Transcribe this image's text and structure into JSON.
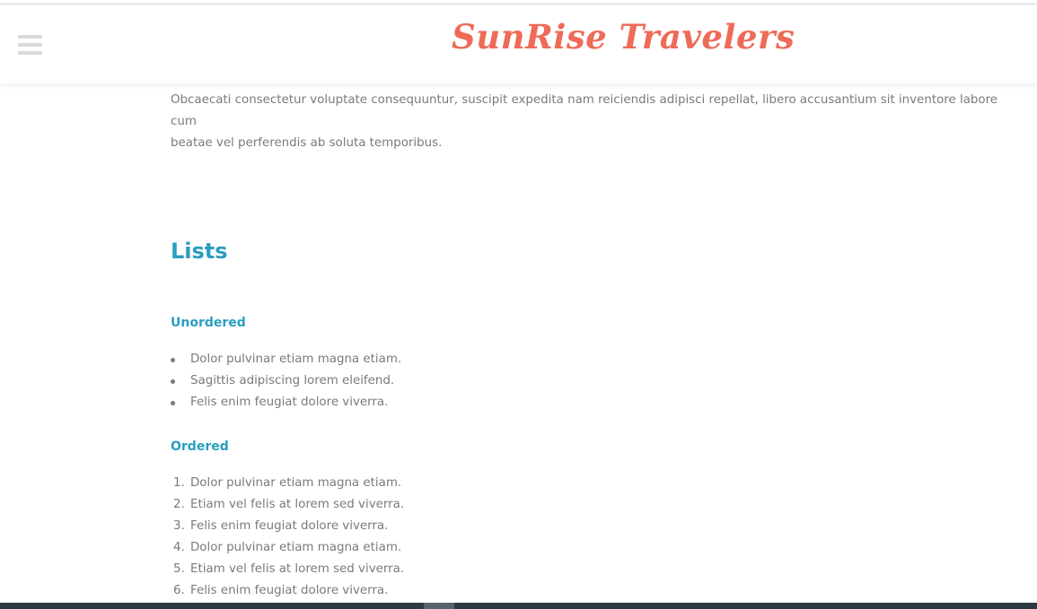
{
  "header": {
    "brand": "SunRise Travelers",
    "menu_icon": "hamburger-menu-icon"
  },
  "content": {
    "paragraph_lines": [
      "Obcaecati consectetur voluptate consequuntur, suscipit expedita nam reiciendis adipisci repellat, libero accusantium sit inventore labore cum",
      "beatae vel perferendis ab soluta temporibus."
    ],
    "lists_heading": "Lists",
    "unordered_heading": "Unordered",
    "unordered_items": [
      "Dolor pulvinar etiam magna etiam.",
      "Sagittis adipiscing lorem eleifend.",
      "Felis enim feugiat dolore viverra."
    ],
    "ordered_heading": "Ordered",
    "ordered_items": [
      {
        "num": "1.",
        "text": "Dolor pulvinar etiam magna etiam."
      },
      {
        "num": "2.",
        "text": "Etiam vel felis at lorem sed viverra."
      },
      {
        "num": "3.",
        "text": "Felis enim feugiat dolore viverra."
      },
      {
        "num": "4.",
        "text": "Dolor pulvinar etiam magna etiam."
      },
      {
        "num": "5.",
        "text": "Etiam vel felis at lorem sed viverra."
      },
      {
        "num": "6.",
        "text": "Felis enim feugiat dolore viverra."
      }
    ]
  },
  "colors": {
    "brand": "#ee6b57",
    "heading": "#2a9dc0",
    "body_text": "#7a7a7a",
    "bottom_bar": "#2d3a44"
  }
}
